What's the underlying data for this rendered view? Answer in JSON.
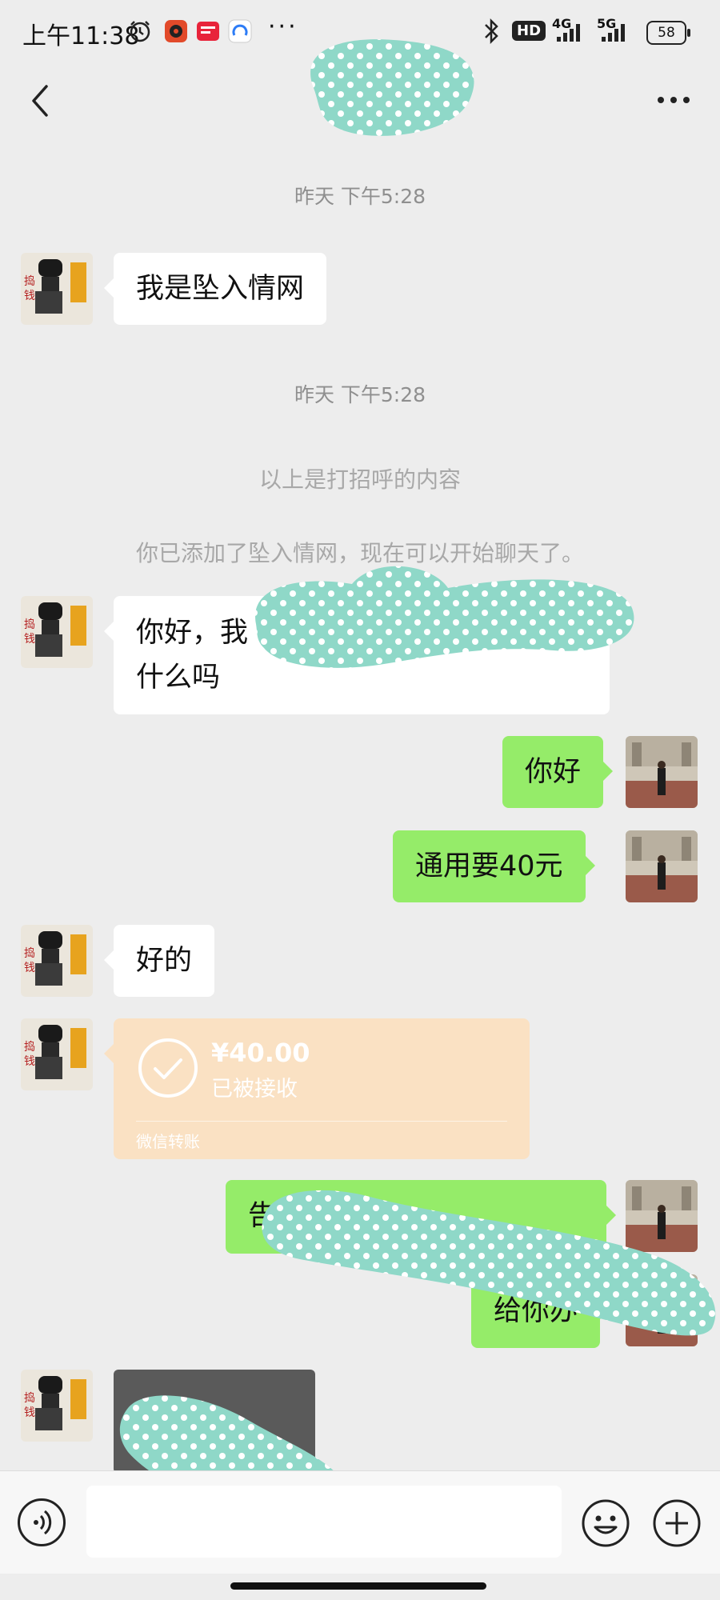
{
  "status_bar": {
    "time": "上午11:38",
    "more": "···",
    "network_1": "4G",
    "network_2": "5G",
    "hd": "HD",
    "battery": "58",
    "icons": [
      "alarm-icon",
      "music-app-icon",
      "news-app-icon",
      "browser-app-icon",
      "bluetooth-icon",
      "signal-icon",
      "signal-icon",
      "battery-icon"
    ]
  },
  "nav": {
    "back_icon": "chevron-left-icon",
    "more_icon": "more-dots-icon"
  },
  "chat": {
    "timestamp_1": "昨天 下午5:28",
    "timestamp_2": "昨天 下午5:28",
    "system_note_1": "以上是打招呼的内容",
    "system_note_2": "你已添加了坠入情网，现在可以开始聊天了。",
    "messages": [
      {
        "side": "in",
        "text": "我是坠入情网"
      },
      {
        "side": "in",
        "text_line_1": "你好，我",
        "text_line_2": "什么吗"
      },
      {
        "side": "out",
        "text": "你好"
      },
      {
        "side": "out",
        "text": "通用要40元"
      },
      {
        "side": "in",
        "text": "好的"
      },
      {
        "side": "out",
        "text": "告"
      },
      {
        "side": "out",
        "text": "给你办"
      }
    ],
    "transfer": {
      "amount": "¥40.00",
      "status": "已被接收",
      "label": "微信转账"
    }
  },
  "input_bar": {
    "placeholder": "",
    "icons": [
      "voice-icon",
      "emoji-icon",
      "plus-icon"
    ]
  },
  "colors": {
    "background": "#ededed",
    "incoming_bubble": "#ffffff",
    "outgoing_bubble": "#95ec69",
    "transfer_card": "#fae1c3",
    "mask": "#8fd8c8"
  }
}
